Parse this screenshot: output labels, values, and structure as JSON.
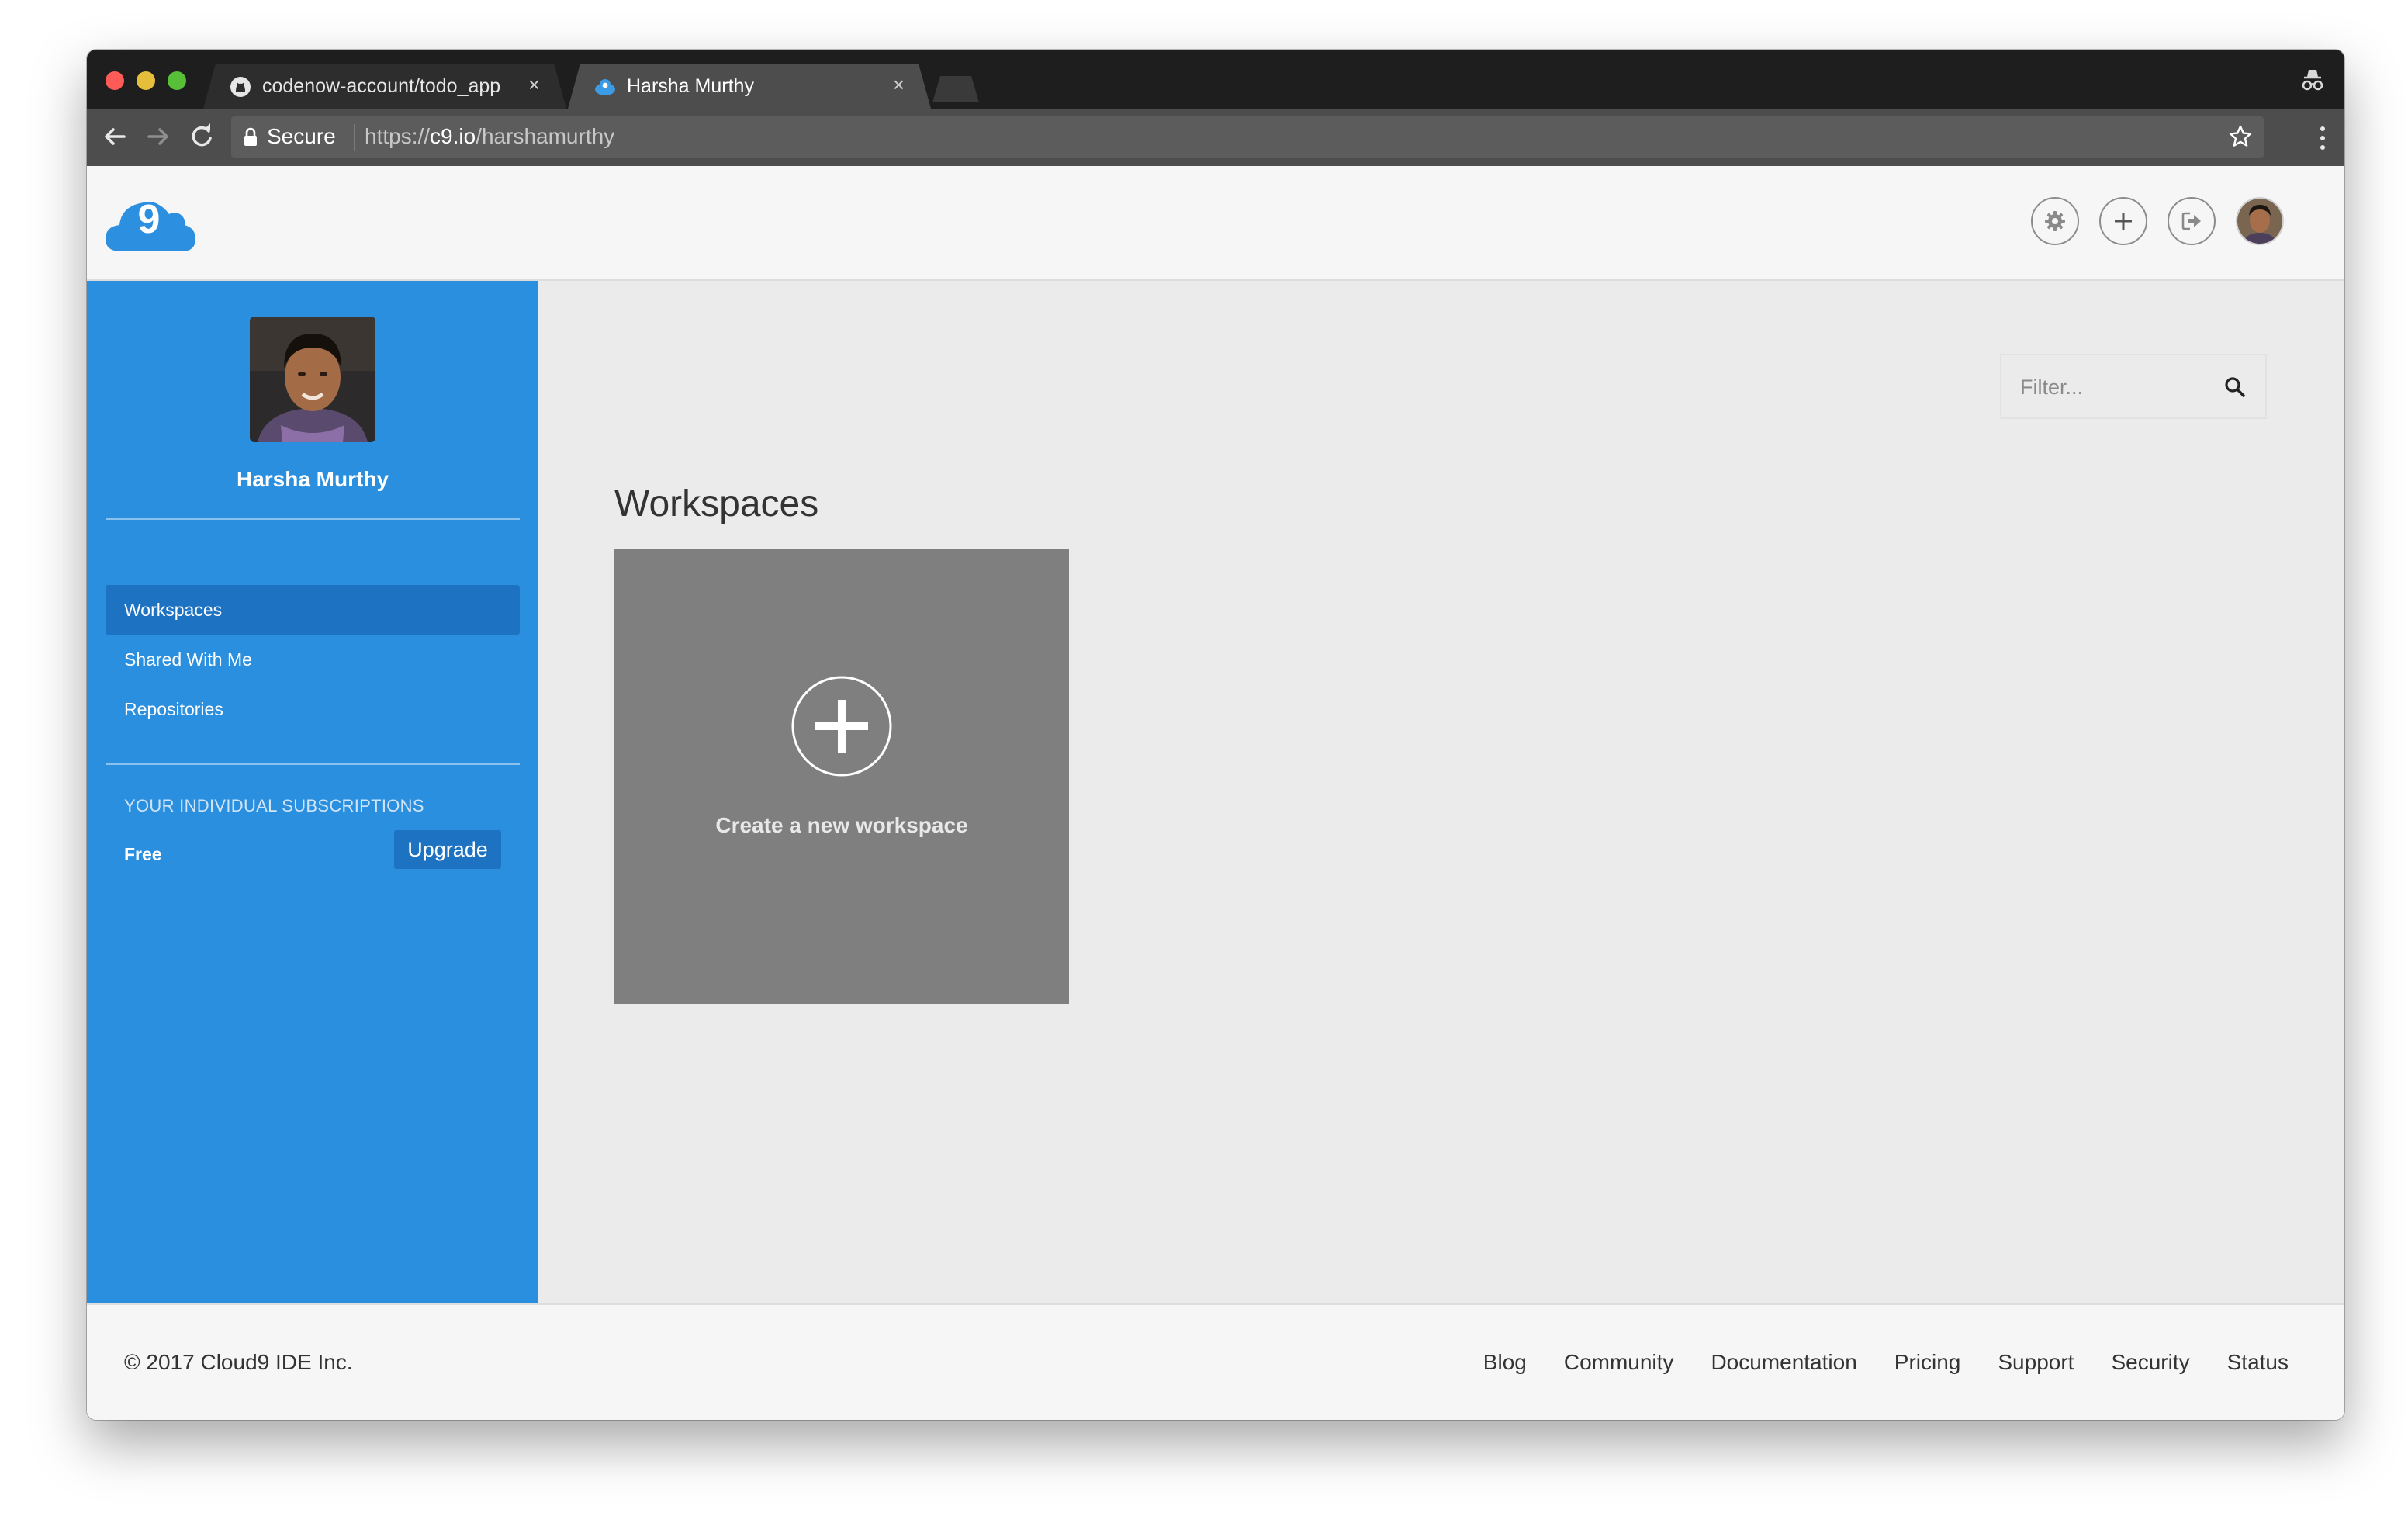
{
  "browser": {
    "tabs": [
      {
        "title": "codenow-account/todo_app",
        "close": "×",
        "favicon": "github-icon"
      },
      {
        "title": "Harsha Murthy",
        "close": "×",
        "favicon": "cloud9-icon"
      }
    ],
    "security_label": "Secure",
    "url_scheme": "https://",
    "url_host": "c9.io",
    "url_path": "/harshamurthy"
  },
  "header": {
    "buttons": [
      "gear-icon",
      "plus-icon",
      "sign-out-icon",
      "avatar"
    ]
  },
  "sidebar": {
    "user_name": "Harsha Murthy",
    "items": [
      {
        "label": "Workspaces",
        "active": true
      },
      {
        "label": "Shared With Me",
        "active": false
      },
      {
        "label": "Repositories",
        "active": false
      }
    ],
    "subscriptions_heading": "YOUR INDIVIDUAL SUBSCRIPTIONS",
    "plan": "Free",
    "upgrade_label": "Upgrade"
  },
  "main": {
    "filter_placeholder": "Filter...",
    "title": "Workspaces",
    "new_workspace_label": "Create a new workspace"
  },
  "footer": {
    "copyright": "© 2017 Cloud9 IDE Inc.",
    "links": [
      "Blog",
      "Community",
      "Documentation",
      "Pricing",
      "Support",
      "Security",
      "Status"
    ]
  },
  "colors": {
    "sidebar_bg": "#2a8fdf",
    "sidebar_active": "#1e72c2",
    "page_bg": "#ebebeb",
    "tile_bg": "#7f7f7f"
  }
}
